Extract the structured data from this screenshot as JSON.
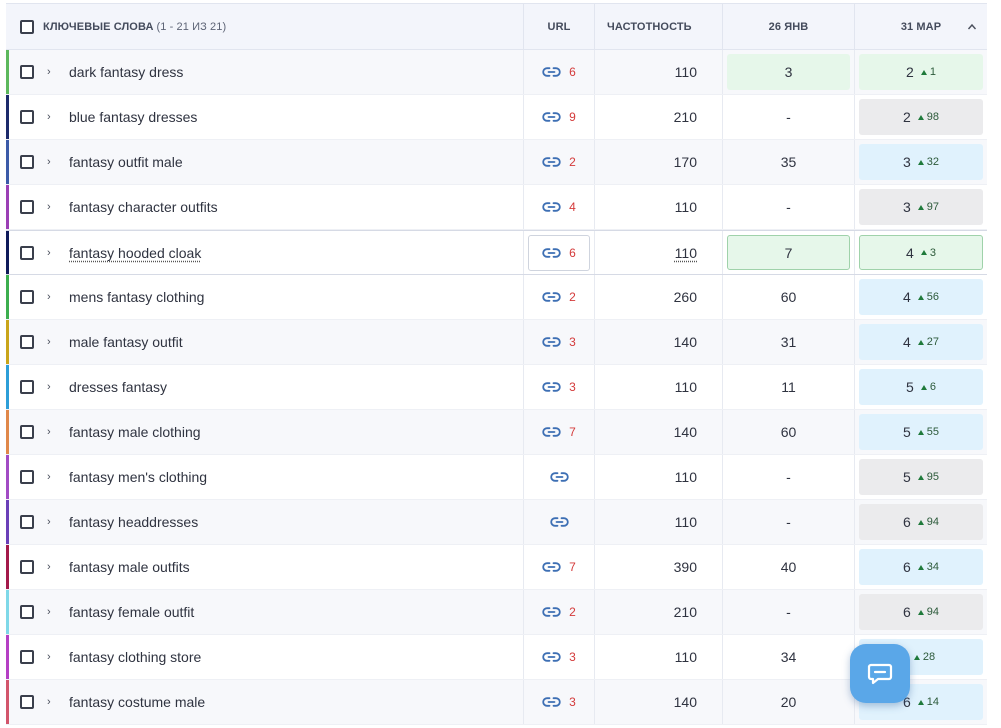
{
  "header": {
    "keywords_label": "КЛЮЧЕВЫЕ СЛОВА",
    "keywords_range": "(1 - 21 ИЗ 21)",
    "url_label": "URL",
    "frequency_label": "ЧАСТОТНОСТЬ",
    "date1_label": "26 ЯНВ",
    "date2_label": "31 МАР"
  },
  "colors": {
    "accent": "#5aa7e8",
    "green_cell": "#e6f7ea",
    "blue_cell": "#e0f2fd",
    "grey_cell": "#ebebed",
    "url_count": "#d43a3a"
  },
  "rows": [
    {
      "keyword": "dark fantasy dress",
      "url_count": "6",
      "frequency": "110",
      "d1": "3",
      "d1_style": "green",
      "d2": "2",
      "d2_delta": "1",
      "d2_style": "green",
      "stripe": "#5cb85c"
    },
    {
      "keyword": "blue fantasy dresses",
      "url_count": "9",
      "frequency": "210",
      "d1": "-",
      "d1_style": "none",
      "d2": "2",
      "d2_delta": "98",
      "d2_style": "grey",
      "stripe": "#1c2a6b"
    },
    {
      "keyword": "fantasy outfit male",
      "url_count": "2",
      "frequency": "170",
      "d1": "35",
      "d1_style": "none",
      "d2": "3",
      "d2_delta": "32",
      "d2_style": "blue",
      "stripe": "#3b5aa8"
    },
    {
      "keyword": "fantasy character outfits",
      "url_count": "4",
      "frequency": "110",
      "d1": "-",
      "d1_style": "none",
      "d2": "3",
      "d2_delta": "97",
      "d2_style": "grey",
      "stripe": "#9b3fb5"
    },
    {
      "keyword": "fantasy hooded cloak",
      "url_count": "6",
      "frequency": "110",
      "d1": "7",
      "d1_style": "green",
      "d2": "4",
      "d2_delta": "3",
      "d2_style": "green",
      "stripe": "#0f1a5a"
    },
    {
      "keyword": "mens fantasy clothing",
      "url_count": "2",
      "frequency": "260",
      "d1": "60",
      "d1_style": "none",
      "d2": "4",
      "d2_delta": "56",
      "d2_style": "blue",
      "stripe": "#3cae4e"
    },
    {
      "keyword": "male fantasy outfit",
      "url_count": "3",
      "frequency": "140",
      "d1": "31",
      "d1_style": "none",
      "d2": "4",
      "d2_delta": "27",
      "d2_style": "blue",
      "stripe": "#c9a51a"
    },
    {
      "keyword": "dresses fantasy",
      "url_count": "3",
      "frequency": "110",
      "d1": "11",
      "d1_style": "none",
      "d2": "5",
      "d2_delta": "6",
      "d2_style": "blue",
      "stripe": "#2d9ed8"
    },
    {
      "keyword": "fantasy male clothing",
      "url_count": "7",
      "frequency": "140",
      "d1": "60",
      "d1_style": "none",
      "d2": "5",
      "d2_delta": "55",
      "d2_style": "blue",
      "stripe": "#e0884a"
    },
    {
      "keyword": "fantasy men's clothing",
      "url_count": "",
      "frequency": "110",
      "d1": "-",
      "d1_style": "none",
      "d2": "5",
      "d2_delta": "95",
      "d2_style": "grey",
      "stripe": "#a24bc4"
    },
    {
      "keyword": "fantasy headdresses",
      "url_count": "",
      "frequency": "110",
      "d1": "-",
      "d1_style": "none",
      "d2": "6",
      "d2_delta": "94",
      "d2_style": "grey",
      "stripe": "#6a3fb8"
    },
    {
      "keyword": "fantasy male outfits",
      "url_count": "7",
      "frequency": "390",
      "d1": "40",
      "d1_style": "none",
      "d2": "6",
      "d2_delta": "34",
      "d2_style": "blue",
      "stripe": "#a3194a"
    },
    {
      "keyword": "fantasy female outfit",
      "url_count": "2",
      "frequency": "210",
      "d1": "-",
      "d1_style": "none",
      "d2": "6",
      "d2_delta": "94",
      "d2_style": "grey",
      "stripe": "#7fd8e8"
    },
    {
      "keyword": "fantasy clothing store",
      "url_count": "3",
      "frequency": "110",
      "d1": "34",
      "d1_style": "none",
      "d2": "",
      "d2_delta": "28",
      "d2_style": "blue",
      "stripe": "#b53fc4"
    },
    {
      "keyword": "fantasy costume male",
      "url_count": "3",
      "frequency": "140",
      "d1": "20",
      "d1_style": "none",
      "d2": "6",
      "d2_delta": "14",
      "d2_style": "blue",
      "stripe": "#d2556b"
    }
  ],
  "hover_row_index": 4,
  "chat_button": {
    "icon": "chat-bubble-icon"
  }
}
